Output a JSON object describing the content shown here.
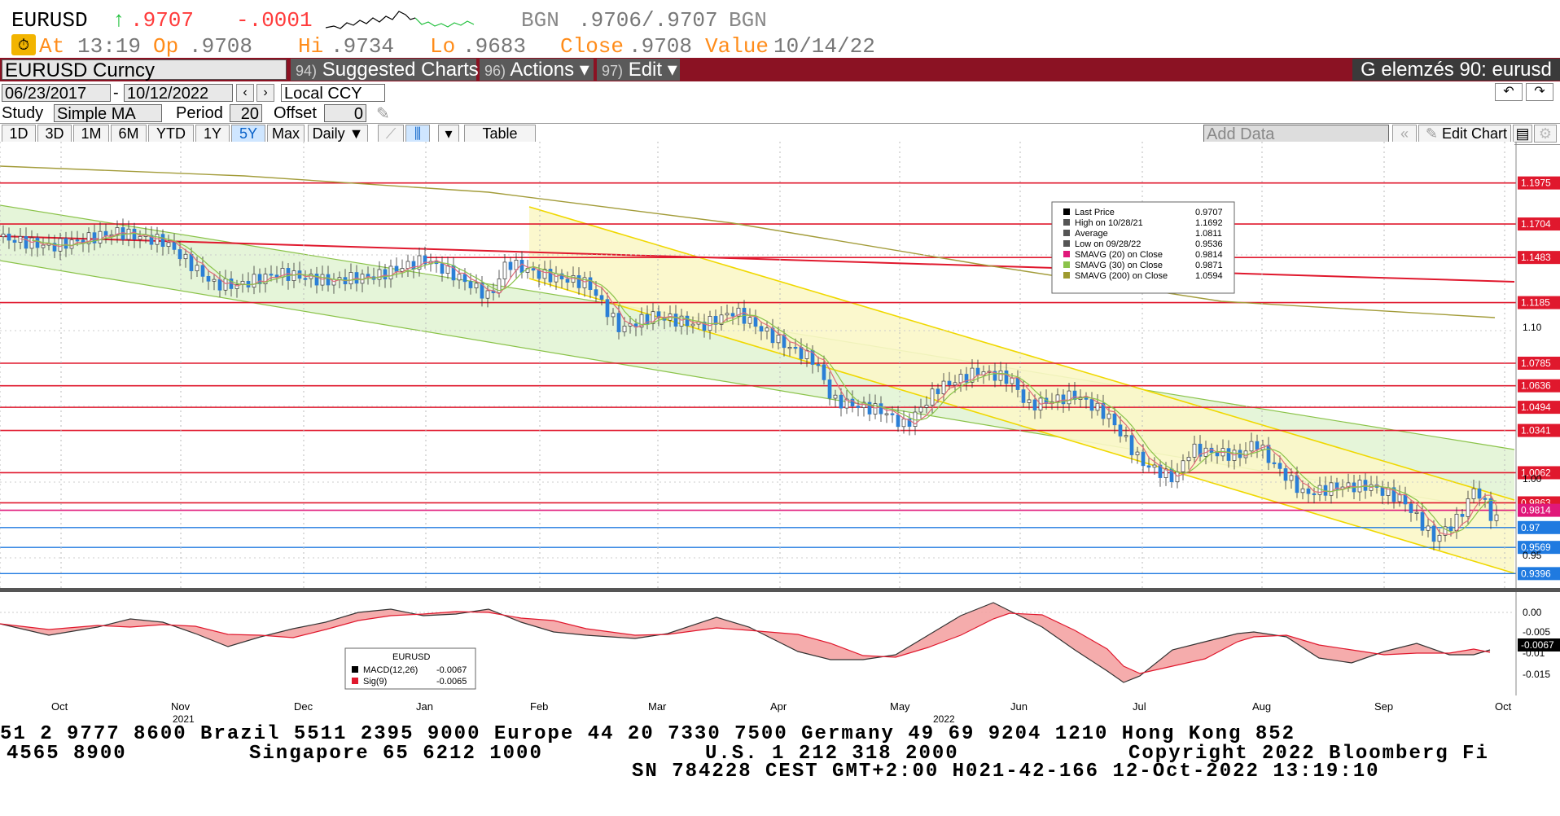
{
  "quote": {
    "ticker": "EURUSD",
    "arrow": "↑",
    "last": ".9707",
    "change": "-.0001",
    "bid_src": "BGN",
    "bid_ask": ".9706/.9707",
    "ask_src": "BGN",
    "at_label": "At",
    "at_time": "13:19",
    "op_label": "Op",
    "op_value": ".9708",
    "hi_label": "Hi",
    "hi_value": ".9734",
    "lo_label": "Lo",
    "lo_value": ".9683",
    "close_label": "Close",
    "close_value": ".9708",
    "value_label": "Value",
    "value_date": "10/14/22",
    "colors": {
      "up": "#1fbf3b",
      "down": "#ff3b3b",
      "orange": "#ff8c1a"
    }
  },
  "titlebar": {
    "security": "EURUSD Curncy",
    "menus": [
      {
        "num": "94)",
        "label": "Suggested Charts"
      },
      {
        "num": "96)",
        "label": "Actions ▾"
      },
      {
        "num": "97)",
        "label": "Edit ▾"
      }
    ],
    "panel": "G elemzés 90: eurusd"
  },
  "toolbar": {
    "start_date": "06/23/2017",
    "end_date": "10/12/2022",
    "currency": "Local CCY",
    "study_label": "Study",
    "study_value": "Simple MA",
    "period_label": "Period",
    "period_value": "20",
    "offset_label": "Offset",
    "offset_value": "0",
    "periods": [
      "1D",
      "3D",
      "1M",
      "6M",
      "YTD",
      "1Y",
      "5Y",
      "Max"
    ],
    "active_period": "5Y",
    "frequency": "Daily ▼",
    "table_label": "Table",
    "add_data_placeholder": "Add Data",
    "edit_chart": "Edit Chart"
  },
  "chart_data": {
    "type": "candlestick",
    "y_price_ticks": [
      "1.10",
      "1.00",
      "0.95"
    ],
    "price_level_labels": [
      {
        "value": "1.1975",
        "color": "#e0182d"
      },
      {
        "value": "1.1704",
        "color": "#e0182d"
      },
      {
        "value": "1.1483",
        "color": "#e0182d"
      },
      {
        "value": "1.1185",
        "color": "#e0182d"
      },
      {
        "value": "1.0785",
        "color": "#e0182d"
      },
      {
        "value": "1.0636",
        "color": "#e0182d"
      },
      {
        "value": "1.0494",
        "color": "#e0182d"
      },
      {
        "value": "1.0341",
        "color": "#e0182d"
      },
      {
        "value": "1.0062",
        "color": "#e0182d"
      },
      {
        "value": "0.9863",
        "color": "#e0182d"
      },
      {
        "value": "0.9814",
        "color": "#e0187a"
      },
      {
        "value": "0.97",
        "color": "#1f7ae0"
      },
      {
        "value": "0.9569",
        "color": "#1f7ae0"
      },
      {
        "value": "0.9396",
        "color": "#1f7ae0"
      }
    ],
    "x_months": [
      "Oct",
      "Nov",
      "Dec",
      "Jan",
      "Feb",
      "Mar",
      "Apr",
      "May",
      "Jun",
      "Jul",
      "Aug",
      "Sep",
      "Oct"
    ],
    "x_years": [
      "2021",
      "2022"
    ],
    "legend": {
      "rows": [
        {
          "label": "Last Price",
          "value": "0.9707",
          "color": "#000000"
        },
        {
          "label": "High on 10/28/21",
          "value": "1.1692",
          "color": "#555555"
        },
        {
          "label": "Average",
          "value": "1.0811",
          "color": "#555555"
        },
        {
          "label": "Low on 09/28/22",
          "value": "0.9536",
          "color": "#555555"
        },
        {
          "label": "SMAVG (20)  on Close",
          "value": "0.9814",
          "color": "#e0187a"
        },
        {
          "label": "SMAVG (30)  on Close",
          "value": "0.9871",
          "color": "#8bc34a"
        },
        {
          "label": "SMAVG (200)  on Close",
          "value": "1.0594",
          "color": "#9e9a2e"
        }
      ]
    },
    "macd": {
      "title": "EURUSD",
      "macd_label": "MACD(12,26)",
      "macd_value": "-0.0067",
      "sig_label": "Sig(9)",
      "sig_value": "-0.0065",
      "y_ticks": [
        "0.00",
        "-0.005",
        "-0.01",
        "-0.015"
      ],
      "current_label": "-0.0067"
    }
  },
  "ticker_tape": {
    "line1": "51 2 9777 8600 Brazil 5511 2395 9000 Europe 44 20 7330 7500 Germany 49 69 9204 1210 Hong Kong 852",
    "line2a": "4565 8900",
    "line2b": "Singapore 65 6212 1000",
    "line2c": "U.S. 1 212 318 2000",
    "line2d": "Copyright 2022 Bloomberg Fi",
    "line3": "SN 784228 CEST GMT+2:00 H021-42-166 12-Oct-2022 13:19:10"
  }
}
